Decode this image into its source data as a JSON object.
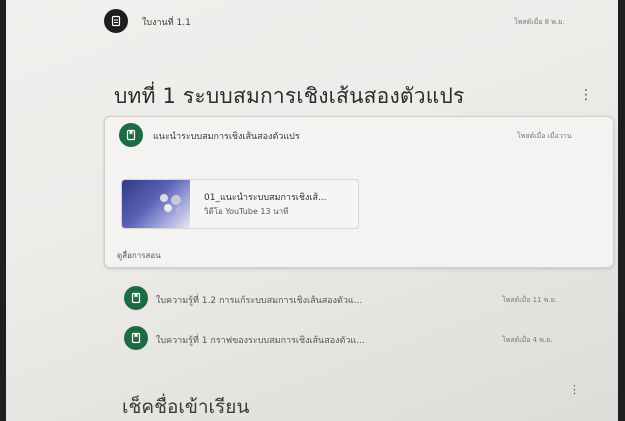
{
  "top_item": {
    "title": "ใบงานที่ 1.1",
    "meta": "โพสต์เมื่อ 8 พ.ย.",
    "icon": "assignment-icon"
  },
  "topic": {
    "title": "บทที่ 1 ระบบสมการเชิงเส้นสองตัวแปร",
    "menu": "⋮"
  },
  "material": {
    "title": "แนะนำระบบสมการเชิงเส้นสองตัวแปร",
    "meta": "โพสต์เมื่อ เมื่อวาน",
    "icon": "material-icon",
    "video": {
      "title": "01_แนะนำระบบสมการเชิงเส้...",
      "meta": "วิดีโอ YouTube  13 นาที"
    },
    "view_link": "ดูสื่อการสอน"
  },
  "items": [
    {
      "title": "ใบความรู้ที่ 1.2 การแก้ระบบสมการเชิงเส้นสองตัวแ...",
      "meta": "โพสต์เมื่อ 11 พ.ย."
    },
    {
      "title": "ใบความรู้ที่ 1 กราฟของระบบสมการเชิงเส้นสองตัวแ...",
      "meta": "โพสต์เมื่อ 4 พ.ย."
    }
  ],
  "next_topic": {
    "title": "เช็คชื่อเข้าเรียน",
    "menu": "⋮"
  },
  "colors": {
    "assignment_icon_bg": "#1e1e1e",
    "material_icon_bg": "#1e6b43"
  }
}
